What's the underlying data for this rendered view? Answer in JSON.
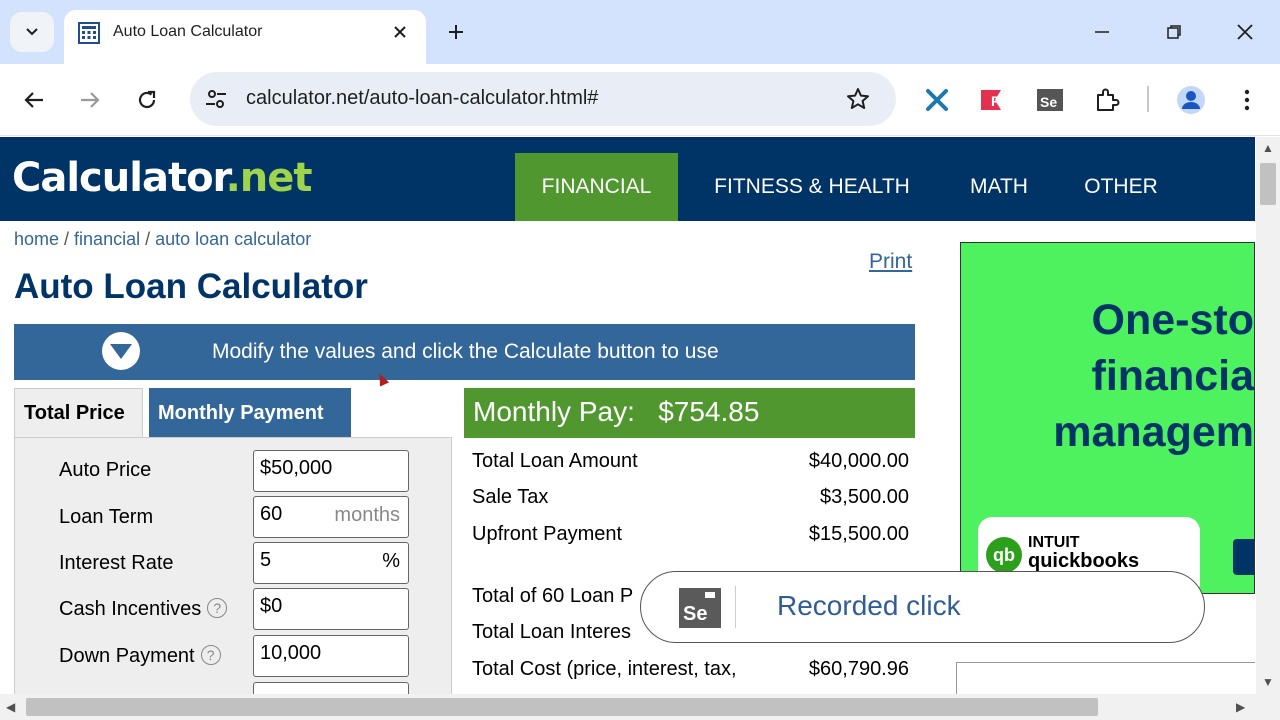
{
  "browser": {
    "tab_title": "Auto Loan Calculator",
    "url": "calculator.net/auto-loan-calculator.html#"
  },
  "header": {
    "logo_main": "Calculator",
    "logo_dot": ".",
    "logo_net": "net",
    "nav": [
      "FINANCIAL",
      "FITNESS & HEALTH",
      "MATH",
      "OTHER"
    ]
  },
  "breadcrumb": {
    "home": "home",
    "sep": " / ",
    "financial": "financial",
    "current": "auto loan calculator"
  },
  "print_label": "Print",
  "page_title": "Auto Loan Calculator",
  "banner_text": "Modify the values and click the Calculate button to use",
  "form_tabs": {
    "total_price": "Total Price",
    "monthly_payment": "Monthly Payment"
  },
  "form": {
    "auto_price_label": "Auto Price",
    "auto_price_value": "$50,000",
    "loan_term_label": "Loan Term",
    "loan_term_value": "60",
    "loan_term_unit": "months",
    "interest_rate_label": "Interest Rate",
    "interest_rate_value": "5",
    "interest_rate_unit": "%",
    "cash_incentives_label": "Cash Incentives",
    "cash_incentives_value": "$0",
    "down_payment_label": "Down Payment",
    "down_payment_value": "10,000",
    "help_glyph": "?"
  },
  "results": {
    "monthly_pay_label": "Monthly Pay:",
    "monthly_pay_value": "$754.85",
    "rows": [
      {
        "label": "Total Loan Amount",
        "value": "$40,000.00"
      },
      {
        "label": "Sale Tax",
        "value": "$3,500.00"
      },
      {
        "label": "Upfront Payment",
        "value": "$15,500.00"
      },
      {
        "label": "Total of 60 Loan P",
        "value": ""
      },
      {
        "label": "Total Loan Interes",
        "value": ""
      },
      {
        "label": "Total Cost (price, interest, tax,",
        "value": "$60,790.96"
      }
    ]
  },
  "ad": {
    "line1": "One-sto",
    "line2": "financia",
    "line3": "managem",
    "brand_top": "INTUIT",
    "brand_bottom": "quickbooks",
    "brand_glyph": "qb"
  },
  "toast": {
    "text": "Recorded click"
  }
}
